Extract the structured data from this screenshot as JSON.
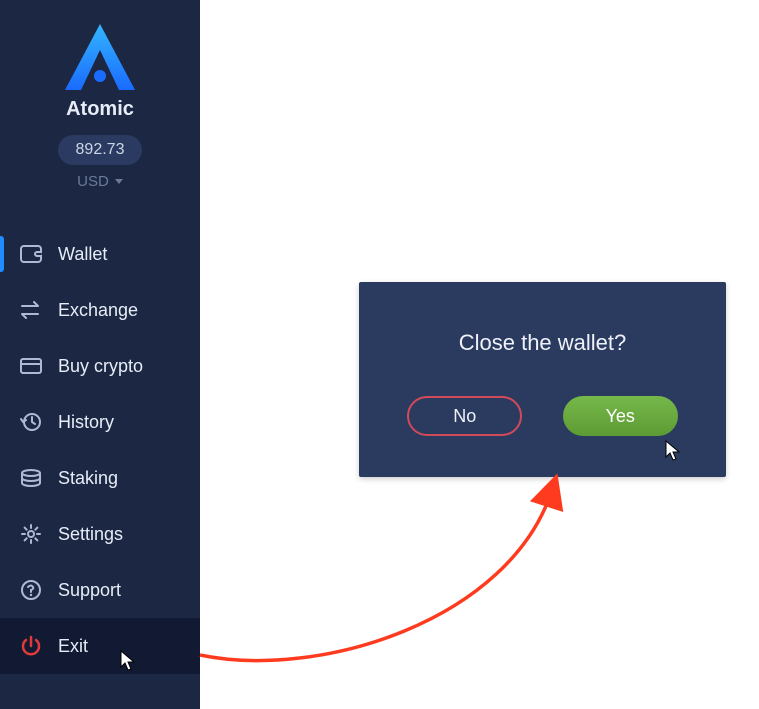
{
  "brand": {
    "name": "Atomic"
  },
  "balance": {
    "value": "892.73",
    "currency": "USD"
  },
  "sidebar": {
    "items": [
      {
        "label": "Wallet",
        "icon": "wallet-icon",
        "active": true
      },
      {
        "label": "Exchange",
        "icon": "exchange-icon"
      },
      {
        "label": "Buy crypto",
        "icon": "card-icon"
      },
      {
        "label": "History",
        "icon": "history-icon"
      },
      {
        "label": "Staking",
        "icon": "staking-icon"
      },
      {
        "label": "Settings",
        "icon": "gear-icon"
      },
      {
        "label": "Support",
        "icon": "help-icon"
      },
      {
        "label": "Exit",
        "icon": "power-icon"
      }
    ]
  },
  "dialog": {
    "title": "Close the wallet?",
    "no_label": "No",
    "yes_label": "Yes"
  },
  "colors": {
    "sidebar_bg": "#1c2744",
    "dialog_bg": "#2b3a5f",
    "accent_blue": "#1f8cff",
    "no_border": "#d14a5a",
    "yes_bg": "#6aa93b",
    "exit_icon": "#e03a3a",
    "annotation": "#ff3b1f"
  }
}
